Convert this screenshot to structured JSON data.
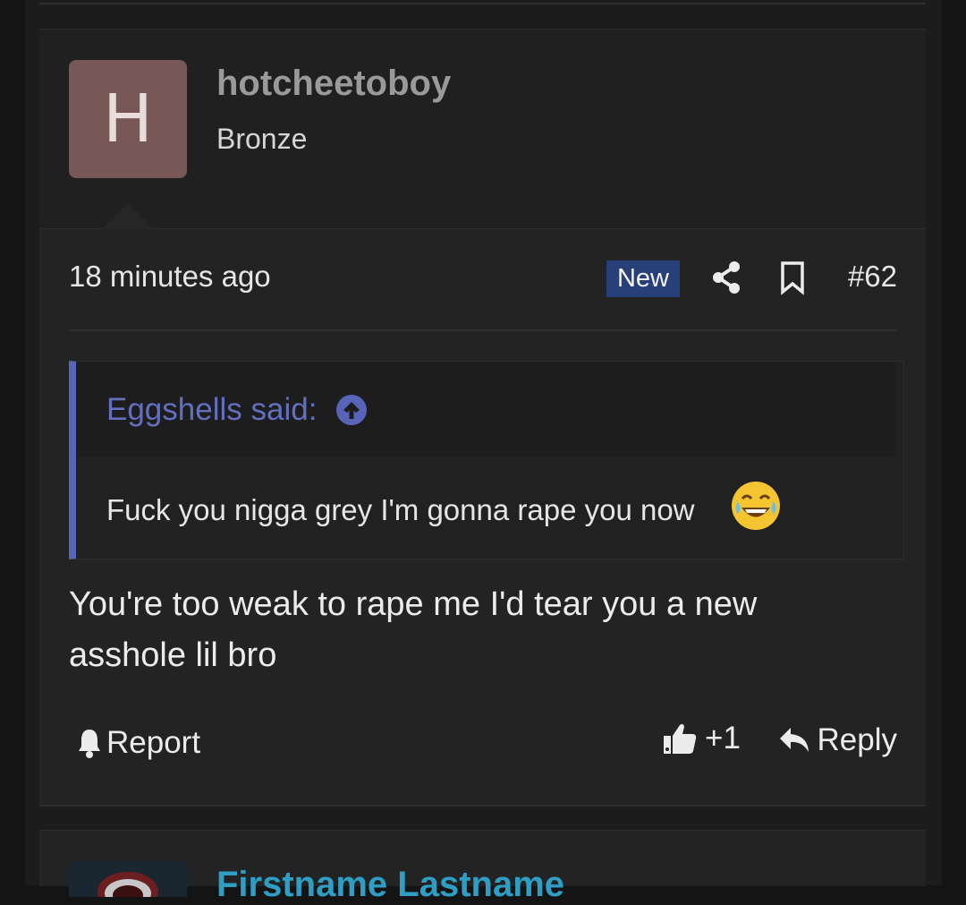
{
  "post": {
    "author": {
      "avatar_letter": "H",
      "avatar_color": "#775857",
      "username": "hotcheetoboy",
      "title": "Bronze"
    },
    "time": "18 minutes ago",
    "badge": "New",
    "badge_color": "#27407a",
    "number": "#62",
    "icons": [
      "share-icon",
      "bookmark-icon"
    ],
    "quote": {
      "attribution": "Eggshells said:",
      "accent_color": "#5864b8",
      "text": "Fuck you nigga grey I'm gonna rape you now",
      "emoji": "grinning-tears-emoji"
    },
    "message": "You're too weak to rape me I'd tear you a new asshole lil bro",
    "actions": {
      "report_label": "Report",
      "like_count": "+1",
      "reply_label": "Reply"
    }
  },
  "next_post": {
    "username": "Firstname Lastname",
    "username_color": "#2f9ec4"
  }
}
